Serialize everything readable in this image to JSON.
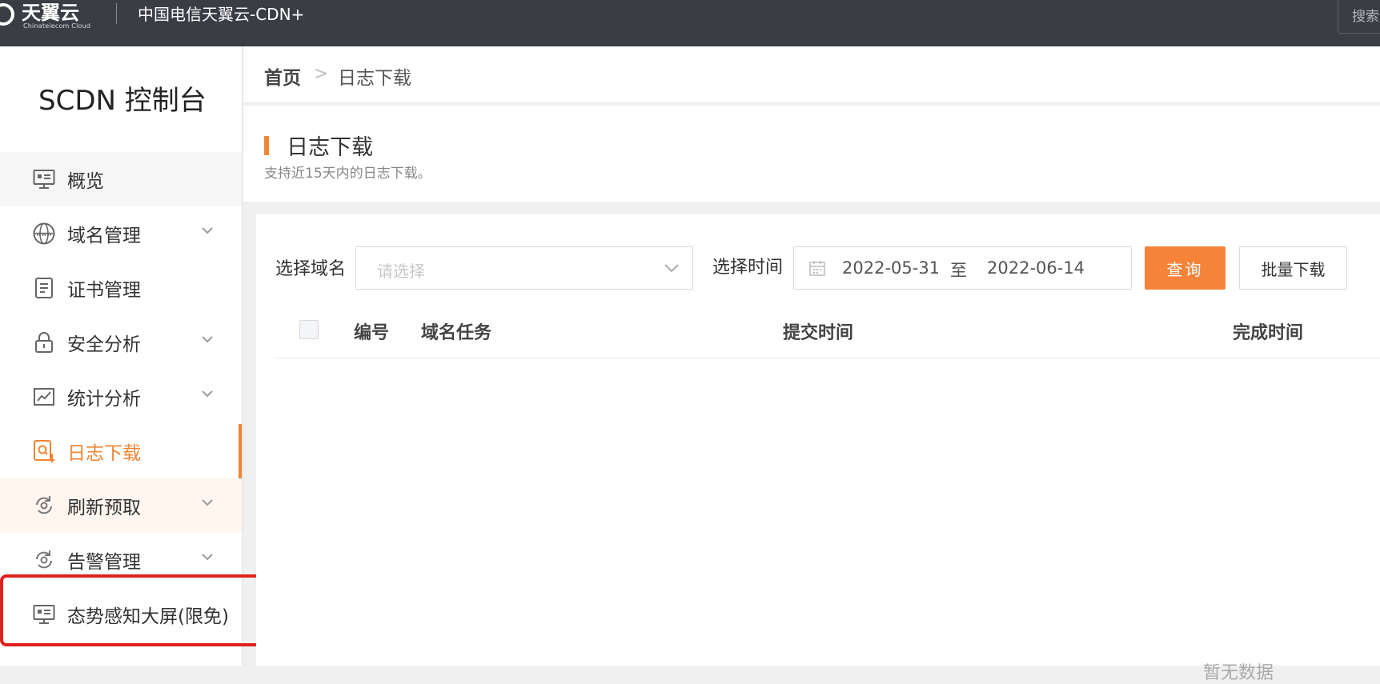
{
  "topbar": {
    "logo_text": "天翼云",
    "logo_sub": "Chinatelecom Cloud",
    "product_title": "中国电信天翼云-CDN+",
    "search_label": "搜索"
  },
  "sidebar": {
    "console_title": "SCDN 控制台",
    "items": [
      {
        "label": "概览",
        "icon": "overview-icon"
      },
      {
        "label": "域名管理",
        "icon": "www-globe-icon"
      },
      {
        "label": "证书管理",
        "icon": "certificate-icon"
      },
      {
        "label": "安全分析",
        "icon": "lock-icon"
      },
      {
        "label": "统计分析",
        "icon": "chart-icon"
      },
      {
        "label": "日志下载",
        "icon": "log-download-icon"
      },
      {
        "label": "刷新预取",
        "icon": "refresh-icon"
      },
      {
        "label": "告警管理",
        "icon": "alarm-icon"
      },
      {
        "label": "态势感知大屏(限免)",
        "icon": "screen-icon"
      }
    ]
  },
  "breadcrumb": {
    "home": "首页",
    "separator": ">",
    "current": "日志下载"
  },
  "page": {
    "title": "日志下载",
    "description": "支持近15天内的日志下载。"
  },
  "filters": {
    "domain_label": "选择域名",
    "domain_placeholder": "请选择",
    "time_label": "选择时间",
    "date_start": "2022-05-31",
    "date_separator": "至",
    "date_end": "2022-06-14",
    "query_button": "查询",
    "batch_download_button": "批量下载"
  },
  "table": {
    "columns": [
      "编号",
      "域名任务",
      "提交时间",
      "完成时间"
    ],
    "rows": [],
    "empty_text": "暂无数据"
  },
  "colors": {
    "accent": "#f08533",
    "topbar": "#3b3d45",
    "highlight": "#e02020"
  }
}
